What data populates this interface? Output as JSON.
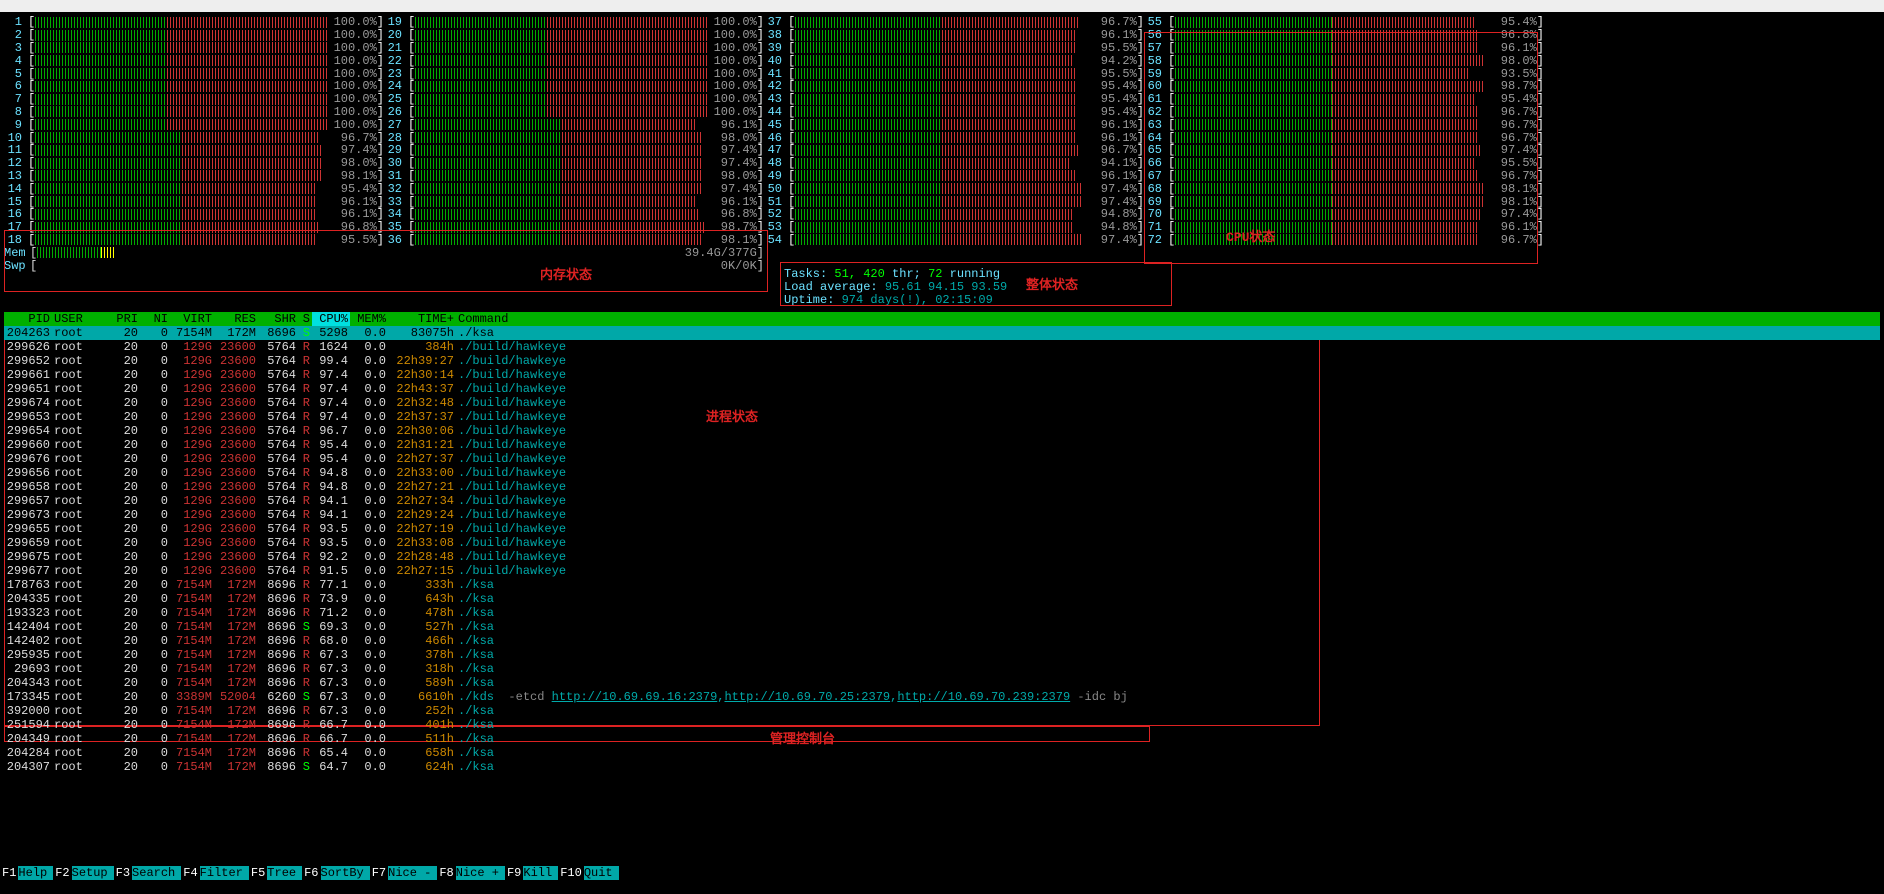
{
  "cpus": [
    {
      "n": 1,
      "pct": "100.0%",
      "split": 45
    },
    {
      "n": 2,
      "pct": "100.0%",
      "split": 45
    },
    {
      "n": 3,
      "pct": "100.0%",
      "split": 45
    },
    {
      "n": 4,
      "pct": "100.0%",
      "split": 45
    },
    {
      "n": 5,
      "pct": "100.0%",
      "split": 45
    },
    {
      "n": 6,
      "pct": "100.0%",
      "split": 45
    },
    {
      "n": 7,
      "pct": "100.0%",
      "split": 45
    },
    {
      "n": 8,
      "pct": "100.0%",
      "split": 45
    },
    {
      "n": 9,
      "pct": "100.0%",
      "split": 45
    },
    {
      "n": 10,
      "pct": "96.7%",
      "split": 50,
      "redStart": 30
    },
    {
      "n": 11,
      "pct": "97.4%",
      "split": 50,
      "redStart": 30
    },
    {
      "n": 12,
      "pct": "98.0%",
      "split": 50,
      "redStart": 30
    },
    {
      "n": 13,
      "pct": "98.1%",
      "split": 50
    },
    {
      "n": 14,
      "pct": "95.4%",
      "split": 50
    },
    {
      "n": 15,
      "pct": "96.1%",
      "split": 50
    },
    {
      "n": 16,
      "pct": "96.1%",
      "split": 50
    },
    {
      "n": 17,
      "pct": "96.8%",
      "split": 50
    },
    {
      "n": 18,
      "pct": "95.5%",
      "split": 50
    },
    {
      "n": 19,
      "pct": "100.0%",
      "split": 45
    },
    {
      "n": 20,
      "pct": "100.0%",
      "split": 45
    },
    {
      "n": 21,
      "pct": "100.0%",
      "split": 45
    },
    {
      "n": 22,
      "pct": "100.0%",
      "split": 45
    },
    {
      "n": 23,
      "pct": "100.0%",
      "split": 45
    },
    {
      "n": 24,
      "pct": "100.0%",
      "split": 45
    },
    {
      "n": 25,
      "pct": "100.0%",
      "split": 45
    },
    {
      "n": 26,
      "pct": "100.0%",
      "split": 45
    },
    {
      "n": 27,
      "pct": "96.1%",
      "split": 50
    },
    {
      "n": 28,
      "pct": "98.0%",
      "split": 50
    },
    {
      "n": 29,
      "pct": "97.4%",
      "split": 50
    },
    {
      "n": 30,
      "pct": "97.4%",
      "split": 50
    },
    {
      "n": 31,
      "pct": "98.0%",
      "split": 50
    },
    {
      "n": 32,
      "pct": "97.4%",
      "split": 50
    },
    {
      "n": 33,
      "pct": "96.1%",
      "split": 50
    },
    {
      "n": 34,
      "pct": "96.8%",
      "split": 50
    },
    {
      "n": 35,
      "pct": "98.7%",
      "split": 50
    },
    {
      "n": 36,
      "pct": "98.1%",
      "split": 50
    },
    {
      "n": 37,
      "pct": "96.7%",
      "split": 50
    },
    {
      "n": 38,
      "pct": "96.1%",
      "split": 50
    },
    {
      "n": 39,
      "pct": "95.5%",
      "split": 50
    },
    {
      "n": 40,
      "pct": "94.2%",
      "split": 50
    },
    {
      "n": 41,
      "pct": "95.5%",
      "split": 50
    },
    {
      "n": 42,
      "pct": "95.4%",
      "split": 50
    },
    {
      "n": 43,
      "pct": "95.4%",
      "split": 50
    },
    {
      "n": 44,
      "pct": "95.4%",
      "split": 50
    },
    {
      "n": 45,
      "pct": "96.1%",
      "split": 50
    },
    {
      "n": 46,
      "pct": "96.1%",
      "split": 50
    },
    {
      "n": 47,
      "pct": "96.7%",
      "split": 50
    },
    {
      "n": 48,
      "pct": "94.1%",
      "split": 50
    },
    {
      "n": 49,
      "pct": "96.1%",
      "split": 50
    },
    {
      "n": 50,
      "pct": "97.4%",
      "split": 50
    },
    {
      "n": 51,
      "pct": "97.4%",
      "split": 50
    },
    {
      "n": 52,
      "pct": "94.8%",
      "split": 50
    },
    {
      "n": 53,
      "pct": "94.8%",
      "split": 50
    },
    {
      "n": 54,
      "pct": "97.4%",
      "split": 50
    },
    {
      "n": 55,
      "pct": "95.4%",
      "split": 50
    },
    {
      "n": 56,
      "pct": "96.8%",
      "split": 50
    },
    {
      "n": 57,
      "pct": "96.1%",
      "split": 50
    },
    {
      "n": 58,
      "pct": "98.0%",
      "split": 50
    },
    {
      "n": 59,
      "pct": "93.5%",
      "split": 50
    },
    {
      "n": 60,
      "pct": "98.7%",
      "split": 50
    },
    {
      "n": 61,
      "pct": "95.4%",
      "split": 50
    },
    {
      "n": 62,
      "pct": "96.7%",
      "split": 50
    },
    {
      "n": 63,
      "pct": "96.7%",
      "split": 50
    },
    {
      "n": 64,
      "pct": "96.7%",
      "split": 50
    },
    {
      "n": 65,
      "pct": "97.4%",
      "split": 50
    },
    {
      "n": 66,
      "pct": "95.5%",
      "split": 50
    },
    {
      "n": 67,
      "pct": "96.7%",
      "split": 50
    },
    {
      "n": 68,
      "pct": "98.1%",
      "split": 50
    },
    {
      "n": 69,
      "pct": "98.1%",
      "split": 50
    },
    {
      "n": 70,
      "pct": "97.4%",
      "split": 50
    },
    {
      "n": 71,
      "pct": "96.1%",
      "split": 50
    },
    {
      "n": 72,
      "pct": "96.7%",
      "split": 50
    }
  ],
  "mem": {
    "label": "Mem",
    "text": "39.4G/377G",
    "used_pct": 10
  },
  "swp": {
    "label": "Swp",
    "text": "0K/0K"
  },
  "summary": {
    "tasks_l": "Tasks:",
    "tasks": " 51, ",
    "thr": "420",
    "thr_l": " thr; ",
    "run": "72",
    "run_l": " running",
    "load_l": "Load average: ",
    "load": "95.61 94.15 93.59",
    "uptime_l": "Uptime: ",
    "uptime": "974 days(!), 02:15:09"
  },
  "annotations": {
    "mem": "内存状态",
    "overall": "整体状态",
    "proc": "进程状态",
    "cpu": "CPU状态",
    "bar": "管理控制台"
  },
  "header": {
    "pid": "PID",
    "user": "USER",
    "pri": "PRI",
    "ni": "NI",
    "virt": "VIRT",
    "res": "RES",
    "shr": "SHR",
    "s": "S",
    "cpu": "CPU%",
    "mem": "MEM%",
    "time": "TIME+",
    "cmd": "Command"
  },
  "procs": [
    {
      "sel": true,
      "pid": "204263",
      "user": "root",
      "pri": "20",
      "ni": "0",
      "virt": "7154M",
      "res": "172M",
      "shr": "8696",
      "s": "S",
      "cpu": "5298",
      "mem": "0.0",
      "time": "83075h",
      "cmd": "./ksa"
    },
    {
      "pid": "299626",
      "user": "root",
      "pri": "20",
      "ni": "0",
      "virt": "129G",
      "res": "23600",
      "shr": "5764",
      "s": "R",
      "cpu": "1624",
      "mem": "0.0",
      "time": "384h",
      "cmd": "./build/hawkeye"
    },
    {
      "pid": "299652",
      "user": "root",
      "pri": "20",
      "ni": "0",
      "virt": "129G",
      "res": "23600",
      "shr": "5764",
      "s": "R",
      "cpu": "99.4",
      "mem": "0.0",
      "time": "22h39:27",
      "cmd": "./build/hawkeye"
    },
    {
      "pid": "299661",
      "user": "root",
      "pri": "20",
      "ni": "0",
      "virt": "129G",
      "res": "23600",
      "shr": "5764",
      "s": "R",
      "cpu": "97.4",
      "mem": "0.0",
      "time": "22h30:14",
      "cmd": "./build/hawkeye"
    },
    {
      "pid": "299651",
      "user": "root",
      "pri": "20",
      "ni": "0",
      "virt": "129G",
      "res": "23600",
      "shr": "5764",
      "s": "R",
      "cpu": "97.4",
      "mem": "0.0",
      "time": "22h43:37",
      "cmd": "./build/hawkeye"
    },
    {
      "pid": "299674",
      "user": "root",
      "pri": "20",
      "ni": "0",
      "virt": "129G",
      "res": "23600",
      "shr": "5764",
      "s": "R",
      "cpu": "97.4",
      "mem": "0.0",
      "time": "22h32:48",
      "cmd": "./build/hawkeye"
    },
    {
      "pid": "299653",
      "user": "root",
      "pri": "20",
      "ni": "0",
      "virt": "129G",
      "res": "23600",
      "shr": "5764",
      "s": "R",
      "cpu": "97.4",
      "mem": "0.0",
      "time": "22h37:37",
      "cmd": "./build/hawkeye"
    },
    {
      "pid": "299654",
      "user": "root",
      "pri": "20",
      "ni": "0",
      "virt": "129G",
      "res": "23600",
      "shr": "5764",
      "s": "R",
      "cpu": "96.7",
      "mem": "0.0",
      "time": "22h30:06",
      "cmd": "./build/hawkeye"
    },
    {
      "pid": "299660",
      "user": "root",
      "pri": "20",
      "ni": "0",
      "virt": "129G",
      "res": "23600",
      "shr": "5764",
      "s": "R",
      "cpu": "95.4",
      "mem": "0.0",
      "time": "22h31:21",
      "cmd": "./build/hawkeye"
    },
    {
      "pid": "299676",
      "user": "root",
      "pri": "20",
      "ni": "0",
      "virt": "129G",
      "res": "23600",
      "shr": "5764",
      "s": "R",
      "cpu": "95.4",
      "mem": "0.0",
      "time": "22h27:37",
      "cmd": "./build/hawkeye"
    },
    {
      "pid": "299656",
      "user": "root",
      "pri": "20",
      "ni": "0",
      "virt": "129G",
      "res": "23600",
      "shr": "5764",
      "s": "R",
      "cpu": "94.8",
      "mem": "0.0",
      "time": "22h33:00",
      "cmd": "./build/hawkeye"
    },
    {
      "pid": "299658",
      "user": "root",
      "pri": "20",
      "ni": "0",
      "virt": "129G",
      "res": "23600",
      "shr": "5764",
      "s": "R",
      "cpu": "94.8",
      "mem": "0.0",
      "time": "22h27:21",
      "cmd": "./build/hawkeye"
    },
    {
      "pid": "299657",
      "user": "root",
      "pri": "20",
      "ni": "0",
      "virt": "129G",
      "res": "23600",
      "shr": "5764",
      "s": "R",
      "cpu": "94.1",
      "mem": "0.0",
      "time": "22h27:34",
      "cmd": "./build/hawkeye"
    },
    {
      "pid": "299673",
      "user": "root",
      "pri": "20",
      "ni": "0",
      "virt": "129G",
      "res": "23600",
      "shr": "5764",
      "s": "R",
      "cpu": "94.1",
      "mem": "0.0",
      "time": "22h29:24",
      "cmd": "./build/hawkeye"
    },
    {
      "pid": "299655",
      "user": "root",
      "pri": "20",
      "ni": "0",
      "virt": "129G",
      "res": "23600",
      "shr": "5764",
      "s": "R",
      "cpu": "93.5",
      "mem": "0.0",
      "time": "22h27:19",
      "cmd": "./build/hawkeye"
    },
    {
      "pid": "299659",
      "user": "root",
      "pri": "20",
      "ni": "0",
      "virt": "129G",
      "res": "23600",
      "shr": "5764",
      "s": "R",
      "cpu": "93.5",
      "mem": "0.0",
      "time": "22h33:08",
      "cmd": "./build/hawkeye"
    },
    {
      "pid": "299675",
      "user": "root",
      "pri": "20",
      "ni": "0",
      "virt": "129G",
      "res": "23600",
      "shr": "5764",
      "s": "R",
      "cpu": "92.2",
      "mem": "0.0",
      "time": "22h28:48",
      "cmd": "./build/hawkeye"
    },
    {
      "pid": "299677",
      "user": "root",
      "pri": "20",
      "ni": "0",
      "virt": "129G",
      "res": "23600",
      "shr": "5764",
      "s": "R",
      "cpu": "91.5",
      "mem": "0.0",
      "time": "22h27:15",
      "cmd": "./build/hawkeye"
    },
    {
      "pid": "178763",
      "user": "root",
      "pri": "20",
      "ni": "0",
      "virt": "7154M",
      "res": "172M",
      "shr": "8696",
      "s": "R",
      "cpu": "77.1",
      "mem": "0.0",
      "time": "333h",
      "cmd": "./ksa"
    },
    {
      "pid": "204335",
      "user": "root",
      "pri": "20",
      "ni": "0",
      "virt": "7154M",
      "res": "172M",
      "shr": "8696",
      "s": "R",
      "cpu": "73.9",
      "mem": "0.0",
      "time": "643h",
      "cmd": "./ksa"
    },
    {
      "pid": "193323",
      "user": "root",
      "pri": "20",
      "ni": "0",
      "virt": "7154M",
      "res": "172M",
      "shr": "8696",
      "s": "R",
      "cpu": "71.2",
      "mem": "0.0",
      "time": "478h",
      "cmd": "./ksa"
    },
    {
      "pid": "142404",
      "user": "root",
      "pri": "20",
      "ni": "0",
      "virt": "7154M",
      "res": "172M",
      "shr": "8696",
      "s": "S",
      "cpu": "69.3",
      "mem": "0.0",
      "time": "527h",
      "cmd": "./ksa"
    },
    {
      "pid": "142402",
      "user": "root",
      "pri": "20",
      "ni": "0",
      "virt": "7154M",
      "res": "172M",
      "shr": "8696",
      "s": "R",
      "cpu": "68.0",
      "mem": "0.0",
      "time": "466h",
      "cmd": "./ksa"
    },
    {
      "pid": "295935",
      "user": "root",
      "pri": "20",
      "ni": "0",
      "virt": "7154M",
      "res": "172M",
      "shr": "8696",
      "s": "R",
      "cpu": "67.3",
      "mem": "0.0",
      "time": "378h",
      "cmd": "./ksa"
    },
    {
      "pid": "29693",
      "user": "root",
      "pri": "20",
      "ni": "0",
      "virt": "7154M",
      "res": "172M",
      "shr": "8696",
      "s": "R",
      "cpu": "67.3",
      "mem": "0.0",
      "time": "318h",
      "cmd": "./ksa"
    },
    {
      "pid": "204343",
      "user": "root",
      "pri": "20",
      "ni": "0",
      "virt": "7154M",
      "res": "172M",
      "shr": "8696",
      "s": "R",
      "cpu": "67.3",
      "mem": "0.0",
      "time": "589h",
      "cmd": "./ksa"
    },
    {
      "pid": "173345",
      "user": "root",
      "pri": "20",
      "ni": "0",
      "virt": "3389M",
      "res": "52004",
      "shr": "6260",
      "s": "S",
      "cpu": "67.3",
      "mem": "0.0",
      "time": "6610h",
      "cmd": "./kds ",
      "extra": " -etcd ",
      "urls": [
        "http://10.69.69.16:2379",
        "http://10.69.70.25:2379",
        "http://10.69.70.239:2379"
      ],
      "tail": " -idc bj"
    },
    {
      "pid": "392000",
      "user": "root",
      "pri": "20",
      "ni": "0",
      "virt": "7154M",
      "res": "172M",
      "shr": "8696",
      "s": "R",
      "cpu": "67.3",
      "mem": "0.0",
      "time": "252h",
      "cmd": "./ksa"
    },
    {
      "pid": "251594",
      "user": "root",
      "pri": "20",
      "ni": "0",
      "virt": "7154M",
      "res": "172M",
      "shr": "8696",
      "s": "R",
      "cpu": "66.7",
      "mem": "0.0",
      "time": "401h",
      "cmd": "./ksa"
    },
    {
      "pid": "204349",
      "user": "root",
      "pri": "20",
      "ni": "0",
      "virt": "7154M",
      "res": "172M",
      "shr": "8696",
      "s": "R",
      "cpu": "66.7",
      "mem": "0.0",
      "time": "511h",
      "cmd": "./ksa"
    },
    {
      "pid": "204284",
      "user": "root",
      "pri": "20",
      "ni": "0",
      "virt": "7154M",
      "res": "172M",
      "shr": "8696",
      "s": "R",
      "cpu": "65.4",
      "mem": "0.0",
      "time": "658h",
      "cmd": "./ksa"
    },
    {
      "pid": "204307",
      "user": "root",
      "pri": "20",
      "ni": "0",
      "virt": "7154M",
      "res": "172M",
      "shr": "8696",
      "s": "S",
      "cpu": "64.7",
      "mem": "0.0",
      "time": "624h",
      "cmd": "./ksa"
    }
  ],
  "footer": [
    {
      "k": "F1",
      "l": "Help"
    },
    {
      "k": "F2",
      "l": "Setup"
    },
    {
      "k": "F3",
      "l": "Search"
    },
    {
      "k": "F4",
      "l": "Filter"
    },
    {
      "k": "F5",
      "l": "Tree"
    },
    {
      "k": "F6",
      "l": "SortBy"
    },
    {
      "k": "F7",
      "l": "Nice -"
    },
    {
      "k": "F8",
      "l": "Nice +"
    },
    {
      "k": "F9",
      "l": "Kill"
    },
    {
      "k": "F10",
      "l": "Quit"
    }
  ]
}
